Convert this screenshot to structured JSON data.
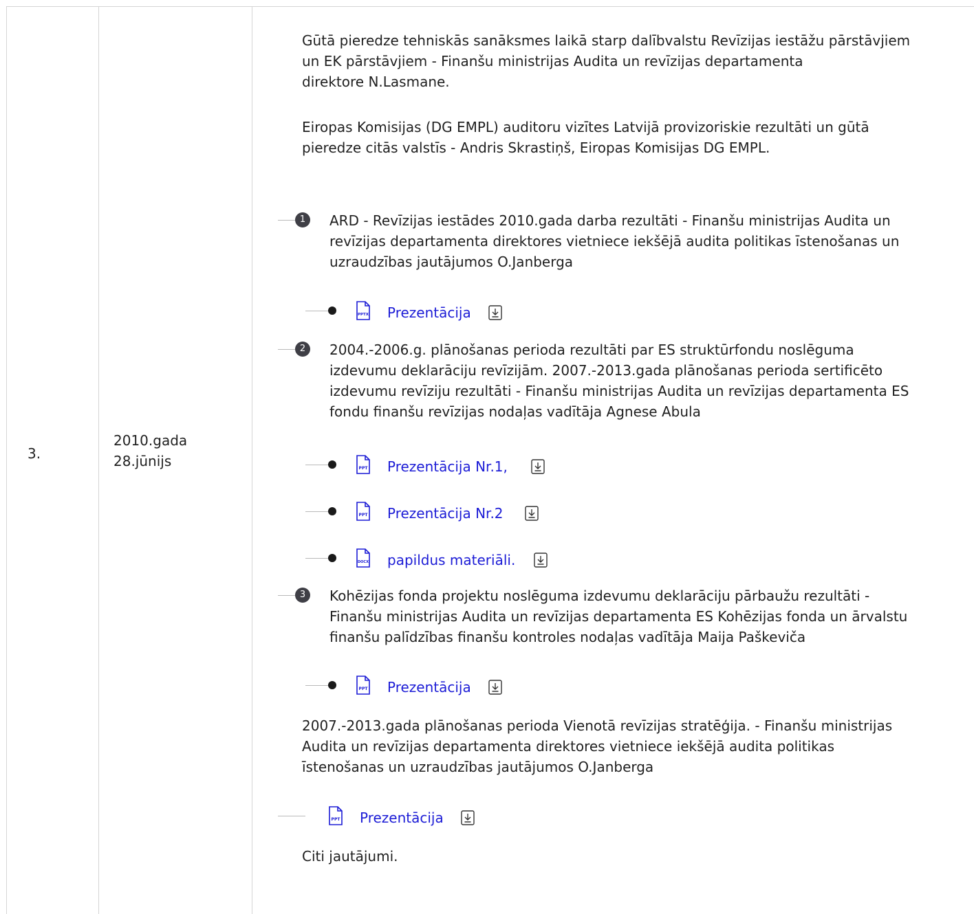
{
  "row": {
    "number": "3.",
    "date_line1": "2010.gada",
    "date_line2": "28.jūnijs"
  },
  "intro": {
    "p1_l1": "Gūtā pieredze tehniskās sanāksmes laikā starp dalībvalstu Revīzijas iestāžu pārstāvjiem",
    "p1_l2": "un EK pārstāvjiem - Finanšu ministrijas Audita un revīzijas departamenta",
    "p1_l3": "direktore N.Lasmane.",
    "p2_l1": "Eiropas Komisijas (DG EMPL) auditoru vizītes Latvijā provizoriskie rezultāti un gūtā",
    "p2_l2": "pieredze citās valstīs - Andris Skrastiņš, Eiropas Komisijas DG EMPL."
  },
  "items": [
    {
      "badge": "1",
      "l1": "ARD - Revīzijas iestādes 2010.gada darba rezultāti - Finanšu ministrijas Audita un",
      "l2": "revīzijas departamenta  direktores vietniece iekšējā audita politikas īstenošanas un",
      "l3": "uzraudzības jautājumos O.Janberga",
      "files": [
        {
          "type": "PPTX",
          "label": "Prezentācija"
        }
      ]
    },
    {
      "badge": "2",
      "l1": "2004.-2006.g. plānošanas perioda rezultāti par ES struktūrfondu  noslēguma",
      "l2": "izdevumu deklarāciju revīzijām. 2007.-2013.gada plānošanas perioda sertificēto",
      "l3": "izdevumu revīziju rezultāti - Finanšu ministrijas Audita un revīzijas departamenta  ES",
      "l4": "fondu finanšu revīzijas nodaļas vadītāja Agnese Abula",
      "files": [
        {
          "type": "PPT",
          "label": "Prezentācija Nr.1,"
        },
        {
          "type": "PPT",
          "label": "Prezentācija Nr.2"
        },
        {
          "type": "DOCX",
          "label": "papildus materiāli."
        }
      ]
    },
    {
      "badge": "3",
      "l1": "Kohēzijas fonda projektu noslēguma izdevumu deklarāciju pārbaužu rezultāti -",
      "l2": "Finanšu ministrijas Audita un revīzijas departamenta ES Kohēzijas fonda un ārvalstu",
      "l3": "finanšu palīdzības finanšu kontroles nodaļas vadītāja Maija Paškeviča",
      "files": [
        {
          "type": "PPT",
          "label": "Prezentācija"
        }
      ]
    }
  ],
  "strategy": {
    "l1": "2007.-2013.gada plānošanas perioda Vienotā revīzijas stratēģija. - Finanšu ministrijas",
    "l2": "Audita un revīzijas departamenta  direktores vietniece iekšējā audita politikas",
    "l3": "īstenošanas un uzraudzības jautājumos O.Janberga",
    "file": {
      "type": "PPT",
      "label": "Prezentācija"
    }
  },
  "other": "Citi jautājumi.",
  "colors": {
    "link": "#1c1cd6",
    "badge": "#3f3f46",
    "border": "#d5d5d5"
  }
}
